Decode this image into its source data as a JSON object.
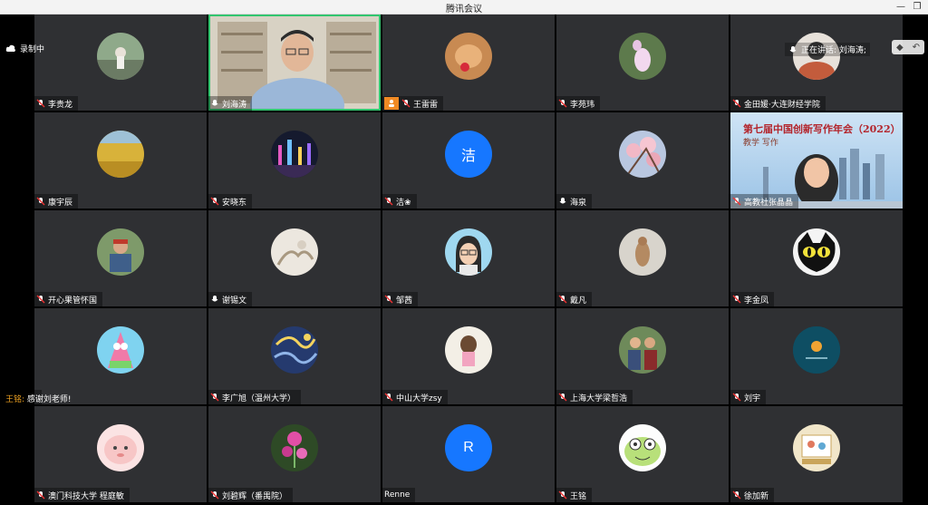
{
  "window": {
    "title": "腾讯会议",
    "minimize": "—",
    "restore": "❐"
  },
  "overlays": {
    "recording": "录制中",
    "speaking": "正在讲话: 刘海涛;",
    "chat": {
      "sender": "王铭:",
      "text": "感谢刘老师!"
    }
  },
  "colors": {
    "accent_green": "#32c56f",
    "avatar_blue": "#1677ff",
    "tile_bg": "#2f3033",
    "badge_orange": "#f08a24"
  },
  "participants": [
    {
      "name": "李贵龙",
      "muted": true
    },
    {
      "name": "刘海涛",
      "muted": false,
      "video": true,
      "speaking": true
    },
    {
      "name": "王雷雷",
      "muted": true
    },
    {
      "name": "李苑玮",
      "muted": true
    },
    {
      "name": "金田媛·大连财经学院",
      "muted": true
    },
    {
      "name": "康宇辰",
      "muted": true
    },
    {
      "name": "安晓东",
      "muted": true
    },
    {
      "name": "洁❀",
      "muted": true,
      "avatar_letter": "洁"
    },
    {
      "name": "海泉",
      "muted": false
    },
    {
      "name": "高教社张晶晶",
      "muted": true,
      "video": true,
      "banner": "第七届中国创新写作年会（2022）",
      "banner_sub": "教学 写作"
    },
    {
      "name": "开心果管怀国",
      "muted": true
    },
    {
      "name": "谢锡文",
      "muted": false
    },
    {
      "name": "邹茜",
      "muted": true
    },
    {
      "name": "戴凡",
      "muted": true
    },
    {
      "name": "李金凤",
      "muted": true
    },
    {
      "name": "",
      "muted": true
    },
    {
      "name": "李广旭（温州大学）",
      "muted": true
    },
    {
      "name": "中山大学zsy",
      "muted": true
    },
    {
      "name": "上海大学梁哲浩",
      "muted": true
    },
    {
      "name": "刘宇",
      "muted": true
    },
    {
      "name": "澳门科技大学 程庭敏",
      "muted": true
    },
    {
      "name": "刘碧辉（番禺院）",
      "muted": true
    },
    {
      "name": "Renne",
      "muted": false,
      "avatar_letter": "R"
    },
    {
      "name": "王铭",
      "muted": true
    },
    {
      "name": "徐加新",
      "muted": true
    }
  ]
}
